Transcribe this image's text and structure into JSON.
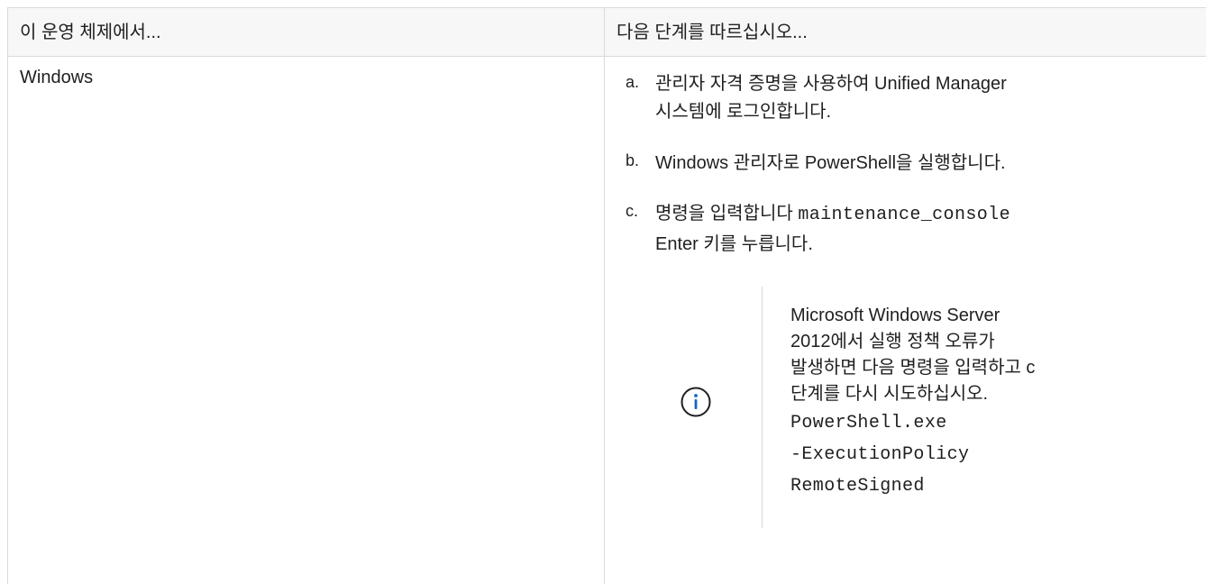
{
  "table": {
    "headers": [
      "이 운영 체제에서...",
      "다음 단계를 따르십시오..."
    ],
    "row": {
      "os": "Windows",
      "steps": [
        {
          "marker": "a.",
          "lines": [
            "관리자 자격 증명을 사용하여 Unified Manager",
            "시스템에 로그인합니다."
          ]
        },
        {
          "marker": "b.",
          "lines": [
            "Windows 관리자로 PowerShell을 실행합니다."
          ]
        },
        {
          "marker": "c.",
          "text_before": "명령을 입력합니다",
          "command": "maintenance_console",
          "text_after": "Enter 키를 누릅니다."
        }
      ],
      "note": {
        "icon": "info-icon",
        "lines": [
          "Microsoft Windows Server",
          "2012에서 실행 정책 오류가",
          "발생하면 다음 명령을 입력하고 c",
          "단계를 다시 시도하십시오."
        ],
        "command_lines": [
          "PowerShell.exe",
          "-ExecutionPolicy",
          "RemoteSigned"
        ]
      }
    }
  },
  "colors": {
    "border": "#dadada",
    "header_bg": "#f7f7f7",
    "icon": "#1565c0",
    "text": "#1f1f1f"
  }
}
